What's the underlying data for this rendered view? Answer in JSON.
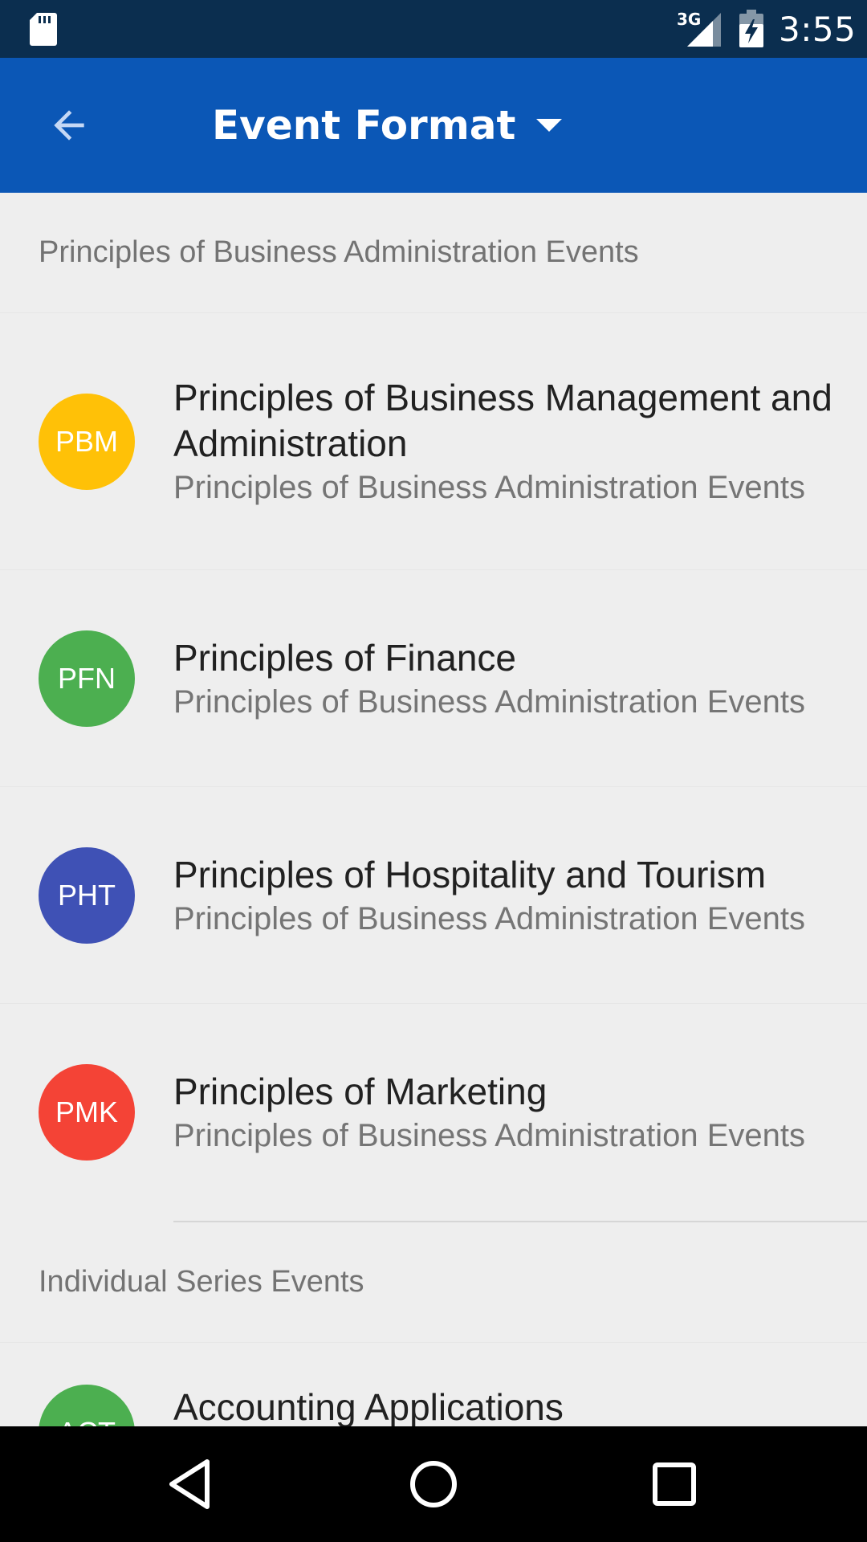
{
  "status_bar": {
    "network": "3G",
    "time": "3:55",
    "icons": [
      "sd-card-icon",
      "signal-icon",
      "battery-charging-icon"
    ]
  },
  "app_bar": {
    "title": "Event Format",
    "back_icon": "arrow-back-icon",
    "dropdown_icon": "arrow-drop-down-icon",
    "background": "#0b57b6"
  },
  "sections": [
    {
      "header": "Principles of Business Administration Events",
      "items": [
        {
          "badge": "PBM",
          "title": "Principles of Business Management and Administration",
          "subtitle": "Principles of Business Administration Events",
          "color": "#ffc107"
        },
        {
          "badge": "PFN",
          "title": "Principles of Finance",
          "subtitle": "Principles of Business Administration Events",
          "color": "#4caf50"
        },
        {
          "badge": "PHT",
          "title": "Principles of Hospitality and Tourism",
          "subtitle": "Principles of Business Administration Events",
          "color": "#3f51b5"
        },
        {
          "badge": "PMK",
          "title": "Principles of Marketing",
          "subtitle": "Principles of Business Administration Events",
          "color": "#f44336"
        }
      ]
    },
    {
      "header": "Individual Series Events",
      "items": [
        {
          "badge": "ACT",
          "title": "Accounting Applications",
          "color": "#4caf50"
        }
      ]
    }
  ],
  "nav_bar": {
    "icons": [
      "nav-back-icon",
      "nav-home-icon",
      "nav-recents-icon"
    ]
  }
}
